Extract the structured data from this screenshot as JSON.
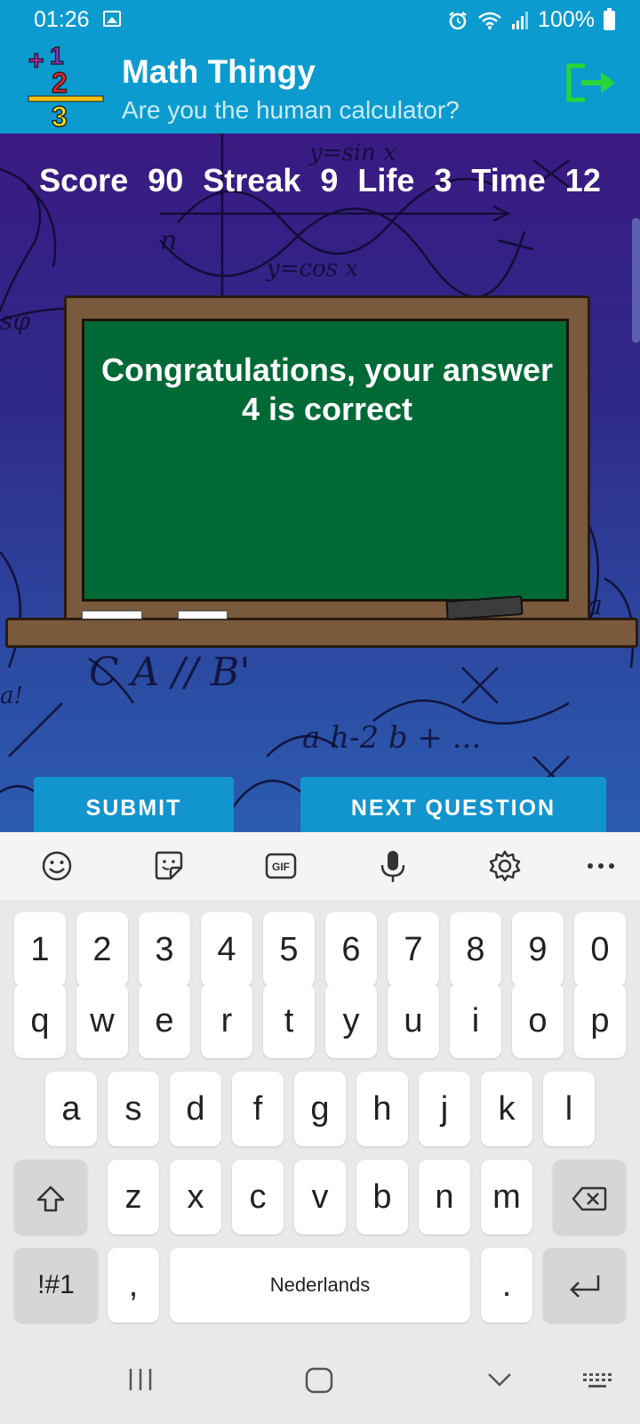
{
  "status_bar": {
    "time": "01:26",
    "battery": "100%",
    "icons": [
      "image-icon",
      "alarm-icon",
      "wifi-icon",
      "signal-icon",
      "battery-icon"
    ]
  },
  "app_bar": {
    "title": "Math Thingy",
    "subtitle": "Are you the human calculator?",
    "logo_icon": "math-logo-icon",
    "exit_icon": "exit-icon"
  },
  "game": {
    "score_label": "Score",
    "score_value": "90",
    "streak_label": "Streak",
    "streak_value": "9",
    "life_label": "Life",
    "life_value": "3",
    "time_label": "Time",
    "time_value": "12",
    "message_line1": "Congratulations, your answer",
    "message_line2": "4 is correct",
    "submit_label": "SUBMIT",
    "next_label": "NEXT QUESTION"
  },
  "keyboard": {
    "toolbar_icons": [
      "emoji-icon",
      "sticker-icon",
      "gif-icon",
      "microphone-icon",
      "settings-icon",
      "more-icon"
    ],
    "gif_text": "GIF",
    "row_numbers": [
      "1",
      "2",
      "3",
      "4",
      "5",
      "6",
      "7",
      "8",
      "9",
      "0"
    ],
    "row1": [
      "q",
      "w",
      "e",
      "r",
      "t",
      "y",
      "u",
      "i",
      "o",
      "p"
    ],
    "row2": [
      "a",
      "s",
      "d",
      "f",
      "g",
      "h",
      "j",
      "k",
      "l"
    ],
    "row3": [
      "z",
      "x",
      "c",
      "v",
      "b",
      "n",
      "m"
    ],
    "symbols_label": "!#1",
    "comma_label": ",",
    "space_label": "Nederlands",
    "period_label": "."
  },
  "colors": {
    "app_bar": "#0b9bcf",
    "chalkboard": "#006a36",
    "frame": "#7a5a3c",
    "button": "#1294cf"
  }
}
